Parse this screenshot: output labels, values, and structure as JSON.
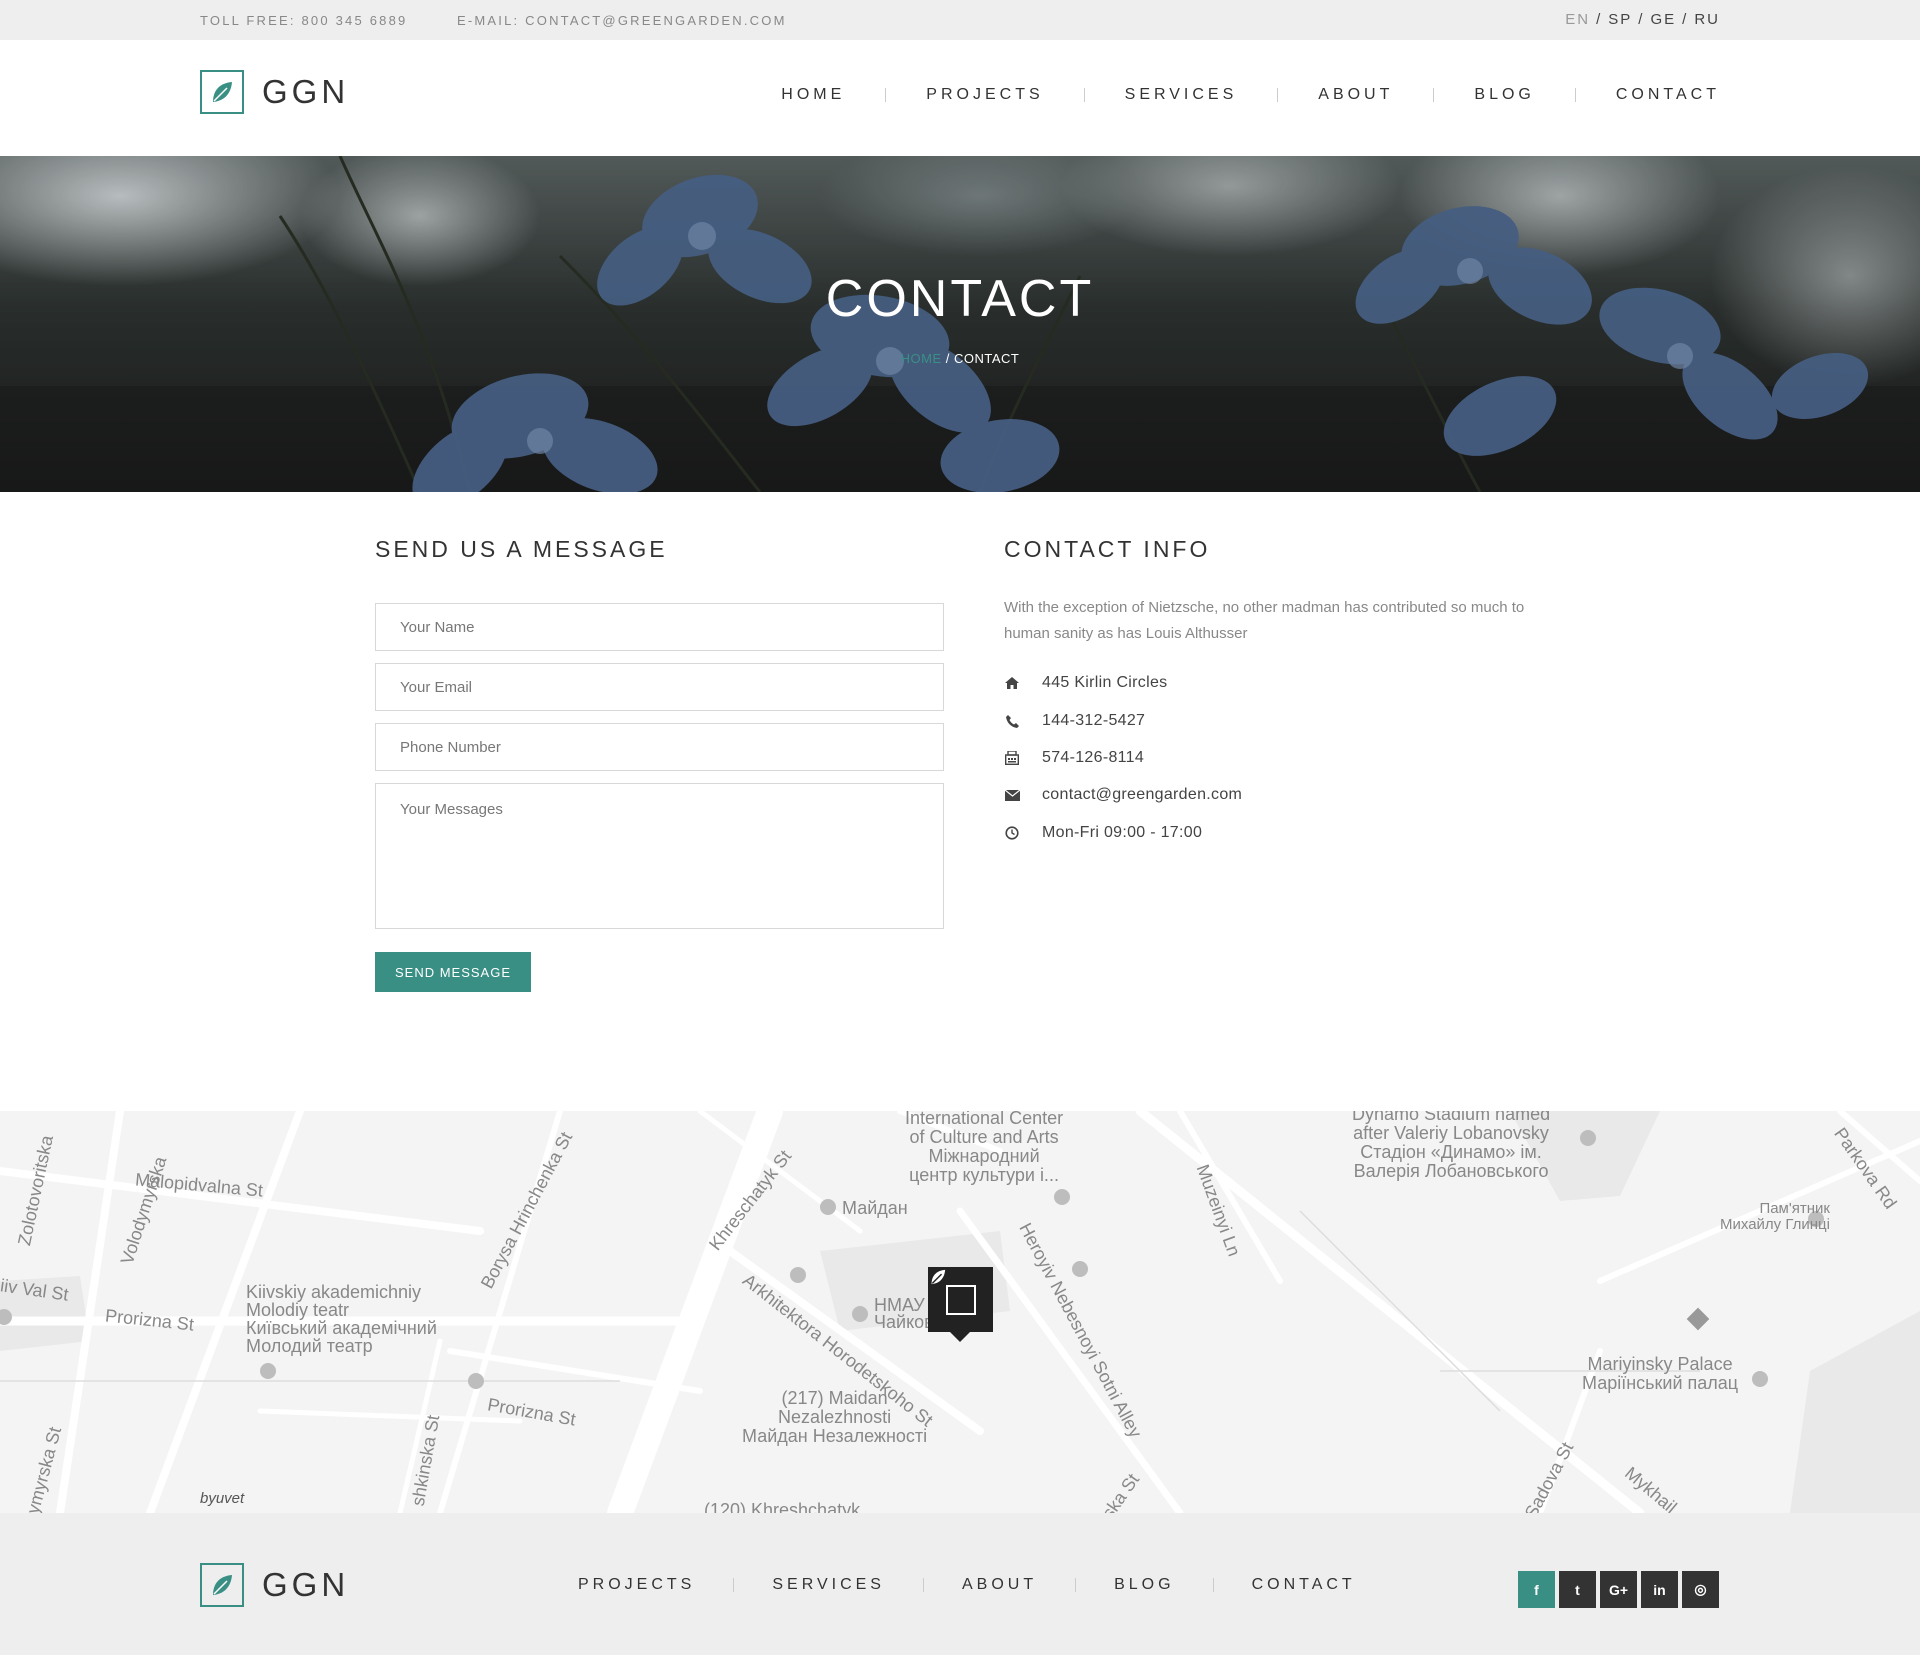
{
  "topbar": {
    "toll_free": "TOLL FREE: 800 345 6889",
    "email": "E-MAIL: CONTACT@GREENGARDEN.COM",
    "languages": [
      "EN",
      "SP",
      "GE",
      "RU"
    ],
    "active_language": "EN"
  },
  "brand": {
    "name": "GGN",
    "accent": "#3a8f85"
  },
  "nav": [
    "HOME",
    "PROJECTS",
    "SERVICES",
    "ABOUT",
    "BLOG",
    "CONTACT"
  ],
  "hero": {
    "title": "CONTACT",
    "breadcrumb_home": "HOME",
    "breadcrumb_sep": " / ",
    "breadcrumb_current": "CONTACT"
  },
  "form": {
    "title": "SEND US A MESSAGE",
    "name_placeholder": "Your Name",
    "email_placeholder": "Your Email",
    "phone_placeholder": "Phone Number",
    "message_placeholder": "Your Messages",
    "submit_label": "SEND MESSAGE"
  },
  "contact_info": {
    "title": "CONTACT INFO",
    "intro": "With the exception of Nietzsche, no other madman has contributed so much to human sanity as has Louis Althusser",
    "items": [
      {
        "icon": "home-icon",
        "text": "445 Kirlin Circles"
      },
      {
        "icon": "phone-icon",
        "text": "144-312-5427"
      },
      {
        "icon": "fax-icon",
        "text": "574-126-8114"
      },
      {
        "icon": "envelope-icon",
        "text": "contact@greengarden.com"
      },
      {
        "icon": "clock-icon",
        "text": "Mon-Fri 09:00 - 17:00"
      }
    ]
  },
  "map": {
    "labels": [
      "International Center",
      "of Culture and Arts",
      "Міжнародний",
      "центр культури і...",
      "Dynamo Stadium named",
      "after Valeriy Lobanovsky",
      "Стадіон «Динамо» ім.",
      "Валерія Лобановського",
      "Malopidvalna St",
      "Volodymyrska",
      "Zolotovoritska",
      "Borysa Hrinchenka St",
      "Khreschatyk St",
      "Майдан",
      "Kiivskiy akademichniy",
      "Molodiy teatr",
      "Київський академічний",
      "Молодий театр",
      "Prorizna St",
      "Prorizna St",
      "iiv Val St",
      "Arkhitektora Horodetskoho St",
      "НМАУ",
      "Чайков",
      "(217) Maidan",
      "Nezalezhnosti",
      "Майдан Незалежності",
      "Heroyiv Nebesnoyi Sotni Alley",
      "Muzeinyi Ln",
      "Пам'ятник",
      "Михайлу Глинці",
      "Parkova Rd",
      "Mariyinsky Palace",
      "Маріїнський палац",
      "Sadova St",
      "Mykhail",
      "byuvet",
      "ymyrska St",
      "shkinska St",
      "(120) Khreshchatyk",
      "ska St"
    ]
  },
  "footer": {
    "nav": [
      "PROJECTS",
      "SERVICES",
      "ABOUT",
      "BLOG",
      "CONTACT"
    ],
    "social": [
      {
        "icon": "facebook-icon",
        "glyph": "f"
      },
      {
        "icon": "twitter-icon",
        "glyph": "t"
      },
      {
        "icon": "google-plus-icon",
        "glyph": "G+"
      },
      {
        "icon": "linkedin-icon",
        "glyph": "in"
      },
      {
        "icon": "instagram-icon",
        "glyph": "◎"
      }
    ]
  }
}
